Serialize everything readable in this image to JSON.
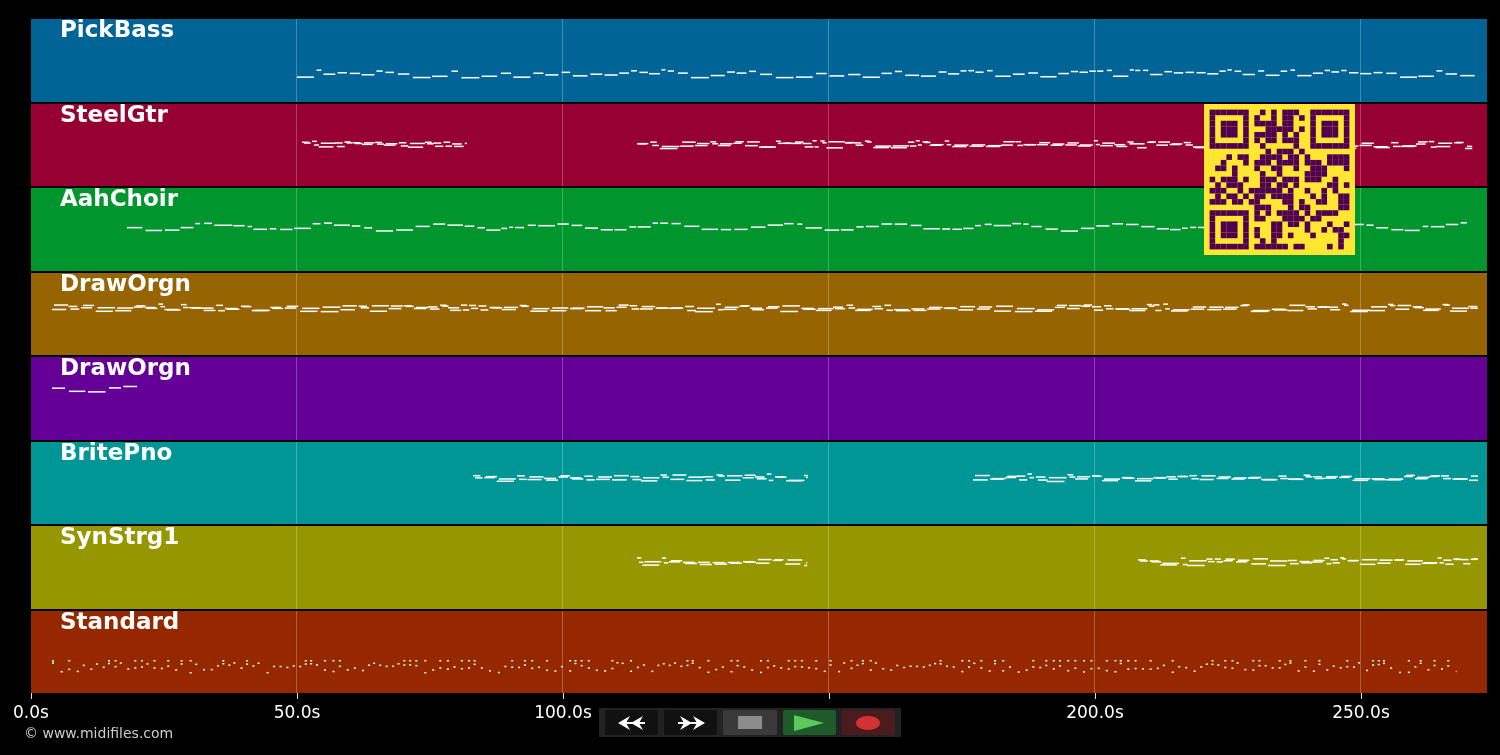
{
  "tracks": [
    {
      "name": "PickBass",
      "color": "#006496"
    },
    {
      "name": "SteelGtr",
      "color": "#960032"
    },
    {
      "name": "AahChoir",
      "color": "#00962d"
    },
    {
      "name": "DrawOrgn",
      "color": "#966400"
    },
    {
      "name": "DrawOrgn",
      "color": "#640096"
    },
    {
      "name": "BritePno",
      "color": "#009696"
    },
    {
      "name": "SynStrg1",
      "color": "#969600"
    },
    {
      "name": "Standard",
      "color": "#962800"
    }
  ],
  "axis": {
    "ticks": [
      "0.0s",
      "50.0s",
      "100.0s",
      "200.0s",
      "250.0s"
    ]
  },
  "transport": [
    {
      "kind": "rewind"
    },
    {
      "kind": "forward"
    },
    {
      "kind": "stop"
    },
    {
      "kind": "play"
    },
    {
      "kind": "record"
    }
  ],
  "copyright": "© www.midifiles.com"
}
